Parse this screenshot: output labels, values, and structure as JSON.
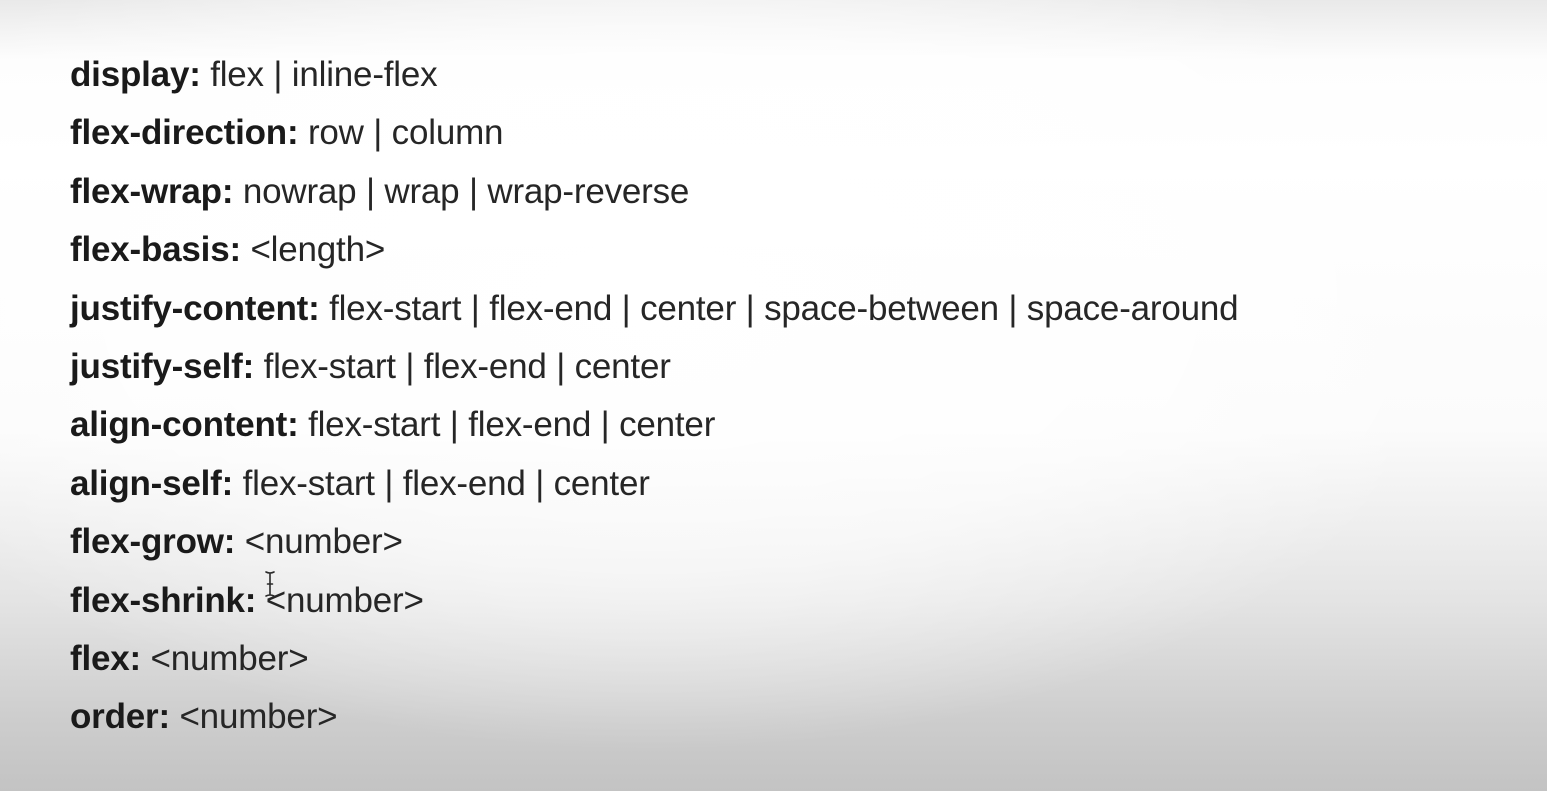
{
  "properties": [
    {
      "name": "display:",
      "values": " flex | inline-flex"
    },
    {
      "name": "flex-direction:",
      "values": " row | column"
    },
    {
      "name": "flex-wrap:",
      "values": " nowrap | wrap | wrap-reverse"
    },
    {
      "name": "flex-basis:",
      "values": " <length>"
    },
    {
      "name": "justify-content:",
      "values": " flex-start | flex-end | center | space-between | space-around"
    },
    {
      "name": "justify-self:",
      "values": " flex-start | flex-end | center"
    },
    {
      "name": "align-content:",
      "values": " flex-start | flex-end | center"
    },
    {
      "name": "align-self:",
      "values": " flex-start | flex-end | center"
    },
    {
      "name": "flex-grow:",
      "values": " <number>"
    },
    {
      "name": "flex-shrink:",
      "values": " <number>"
    },
    {
      "name": "flex:",
      "values": " <number>"
    },
    {
      "name": "order:",
      "values": " <number>"
    }
  ],
  "cursor": {
    "icon": "text-cursor-icon"
  }
}
